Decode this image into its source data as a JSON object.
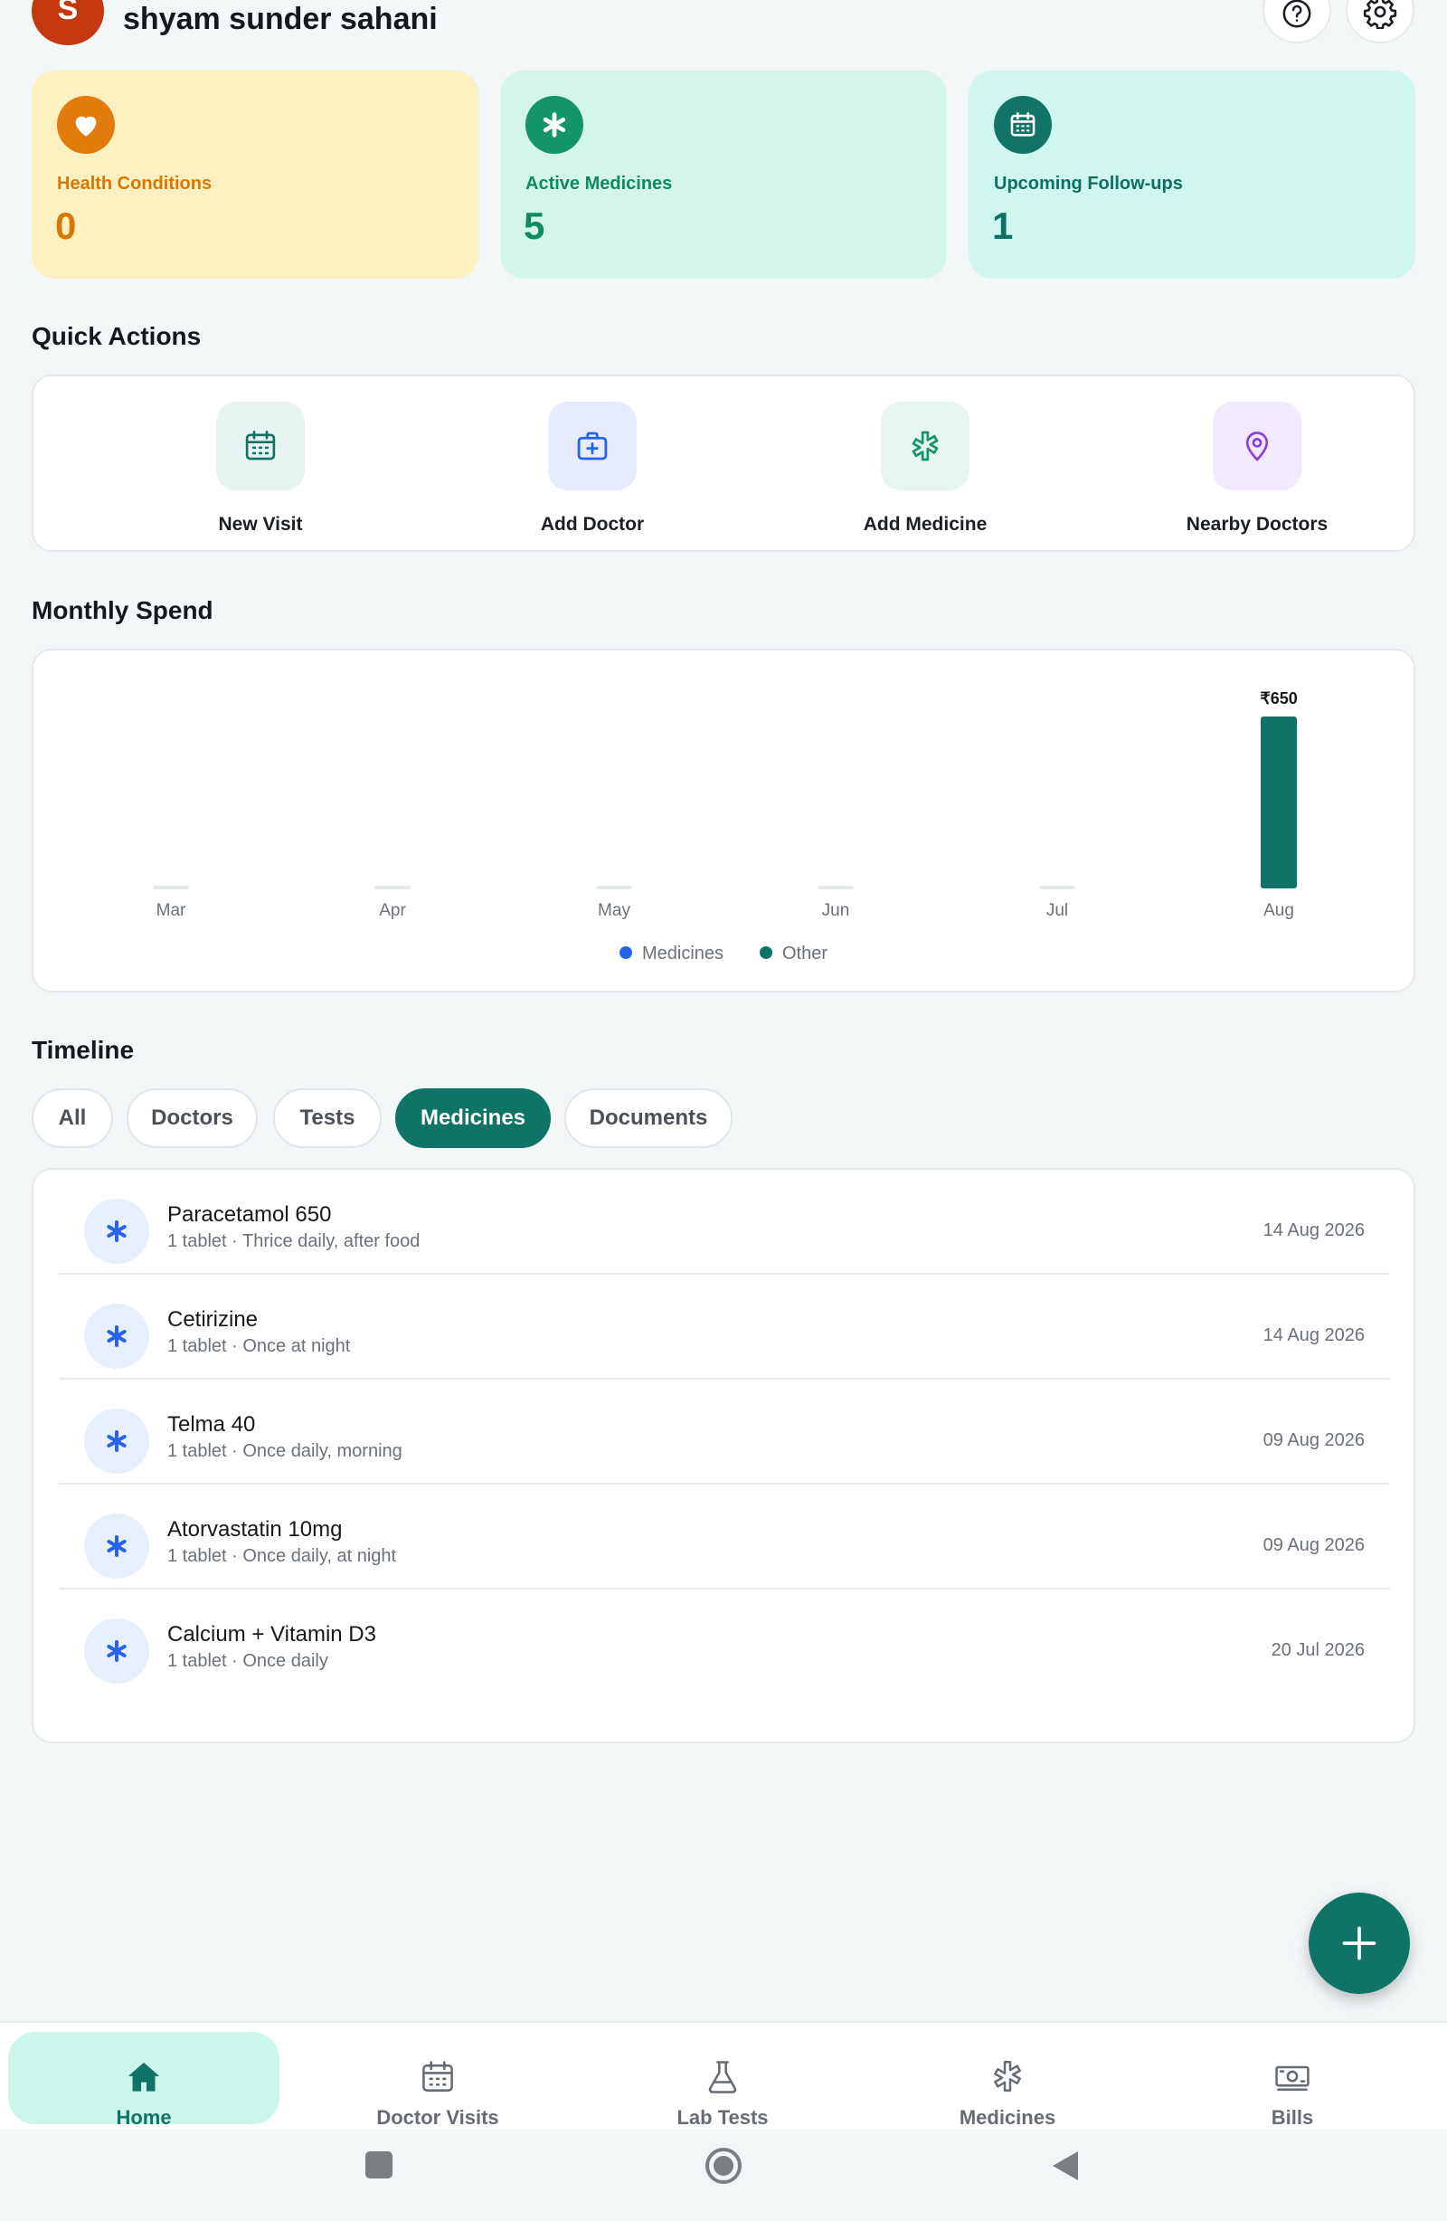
{
  "header": {
    "avatar_letter": "S",
    "user_name": "shyam sunder sahani"
  },
  "stats": [
    {
      "label": "Health Conditions",
      "value": "0",
      "icon": "heart-icon",
      "color": "#e07b0c"
    },
    {
      "label": "Active Medicines",
      "value": "5",
      "icon": "asterisk-icon",
      "color": "#14946a"
    },
    {
      "label": "Upcoming Follow-ups",
      "value": "1",
      "icon": "calendar-icon",
      "color": "#117467"
    }
  ],
  "quick_actions": {
    "title": "Quick Actions",
    "items": [
      {
        "label": "New Visit",
        "icon": "calendar-icon"
      },
      {
        "label": "Add Doctor",
        "icon": "medical-bag-icon"
      },
      {
        "label": "Add Medicine",
        "icon": "medicine-icon"
      },
      {
        "label": "Nearby Doctors",
        "icon": "location-pin-icon"
      }
    ]
  },
  "monthly_spend": {
    "title": "Monthly Spend"
  },
  "chart_data": {
    "type": "bar",
    "categories": [
      "Mar",
      "Apr",
      "May",
      "Jun",
      "Jul",
      "Aug"
    ],
    "series": [
      {
        "name": "Medicines",
        "values": [
          0,
          0,
          0,
          0,
          0,
          0
        ],
        "color": "#2563eb"
      },
      {
        "name": "Other",
        "values": [
          0,
          0,
          0,
          0,
          0,
          650
        ],
        "color": "#0f7465"
      }
    ],
    "data_labels": [
      "",
      "",
      "",
      "",
      "",
      "₹650"
    ],
    "ylim": [
      0,
      650
    ],
    "grid": false,
    "legend": "bottom-center"
  },
  "timeline": {
    "title": "Timeline",
    "filters": [
      {
        "label": "All",
        "active": false
      },
      {
        "label": "Doctors",
        "active": false
      },
      {
        "label": "Tests",
        "active": false
      },
      {
        "label": "Medicines",
        "active": true
      },
      {
        "label": "Documents",
        "active": false
      }
    ],
    "items": [
      {
        "name": "Paracetamol 650",
        "detail": "1 tablet · Thrice daily, after food",
        "date": "14 Aug 2026"
      },
      {
        "name": "Cetirizine",
        "detail": "1 tablet · Once at night",
        "date": "14 Aug 2026"
      },
      {
        "name": "Telma 40",
        "detail": "1 tablet · Once daily, morning",
        "date": "09 Aug 2026"
      },
      {
        "name": "Atorvastatin 10mg",
        "detail": "1 tablet · Once daily, at night",
        "date": "09 Aug 2026"
      },
      {
        "name": "Calcium + Vitamin D3",
        "detail": "1 tablet · Once daily",
        "date": "20 Jul 2026"
      }
    ]
  },
  "bottom_nav": [
    {
      "label": "Home",
      "icon": "home-icon",
      "active": true
    },
    {
      "label": "Doctor Visits",
      "icon": "calendar-icon",
      "active": false
    },
    {
      "label": "Lab Tests",
      "icon": "flask-icon",
      "active": false
    },
    {
      "label": "Medicines",
      "icon": "medicine-icon",
      "active": false
    },
    {
      "label": "Bills",
      "icon": "banknote-icon",
      "active": false
    }
  ],
  "colors": {
    "accent": "#0f7465",
    "background": "#f3f7f8"
  }
}
